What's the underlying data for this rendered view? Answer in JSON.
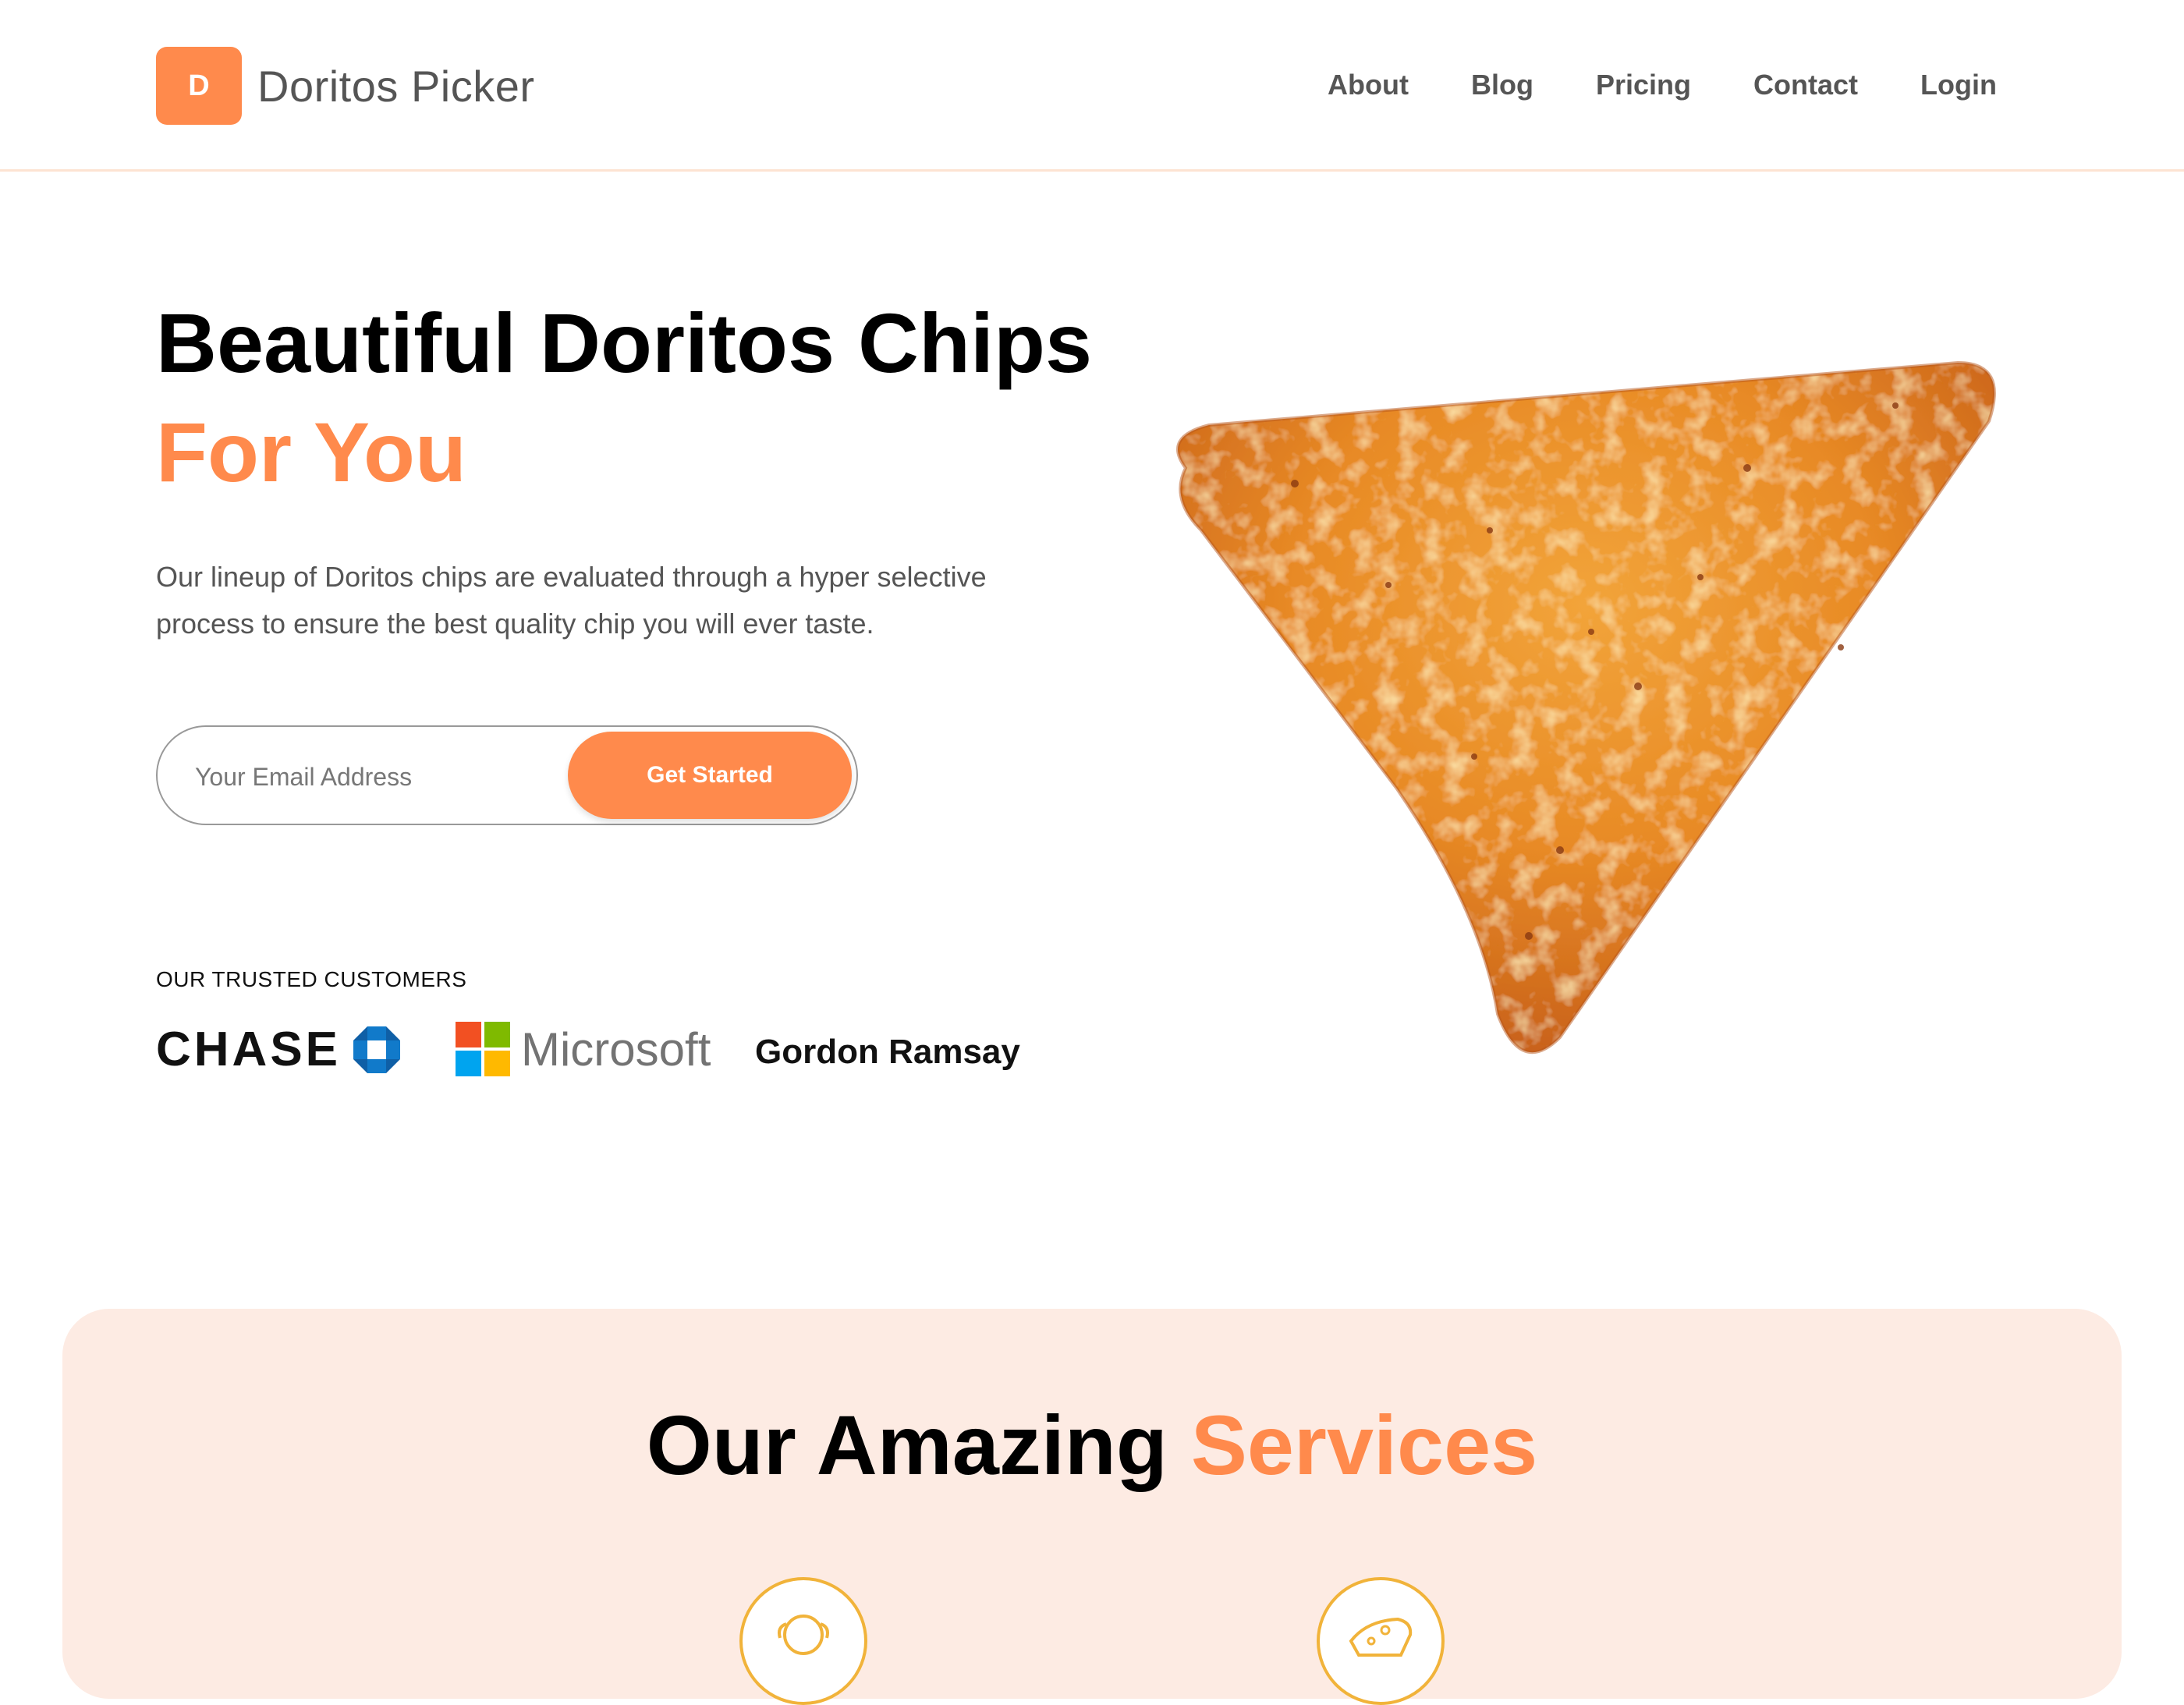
{
  "brand": {
    "initial": "D",
    "name": "Doritos Picker",
    "accent_color": "#ff8a4c"
  },
  "nav": {
    "items": [
      "About",
      "Blog",
      "Pricing",
      "Contact",
      "Login"
    ]
  },
  "hero": {
    "title_line1": "Beautiful Doritos Chips",
    "title_line2": "For You",
    "description": "Our lineup of Doritos chips are evaluated through a hyper selective process to ensure the best quality chip you will ever taste.",
    "email_placeholder": "Your Email Address",
    "cta_label": "Get Started"
  },
  "trusted": {
    "label": "OUR TRUSTED CUSTOMERS",
    "customers": [
      "CHASE",
      "Microsoft",
      "Gordon Ramsay"
    ]
  },
  "services": {
    "title_part1": "Our Amazing",
    "title_part2": "Services",
    "background_color": "#fdebe3"
  }
}
